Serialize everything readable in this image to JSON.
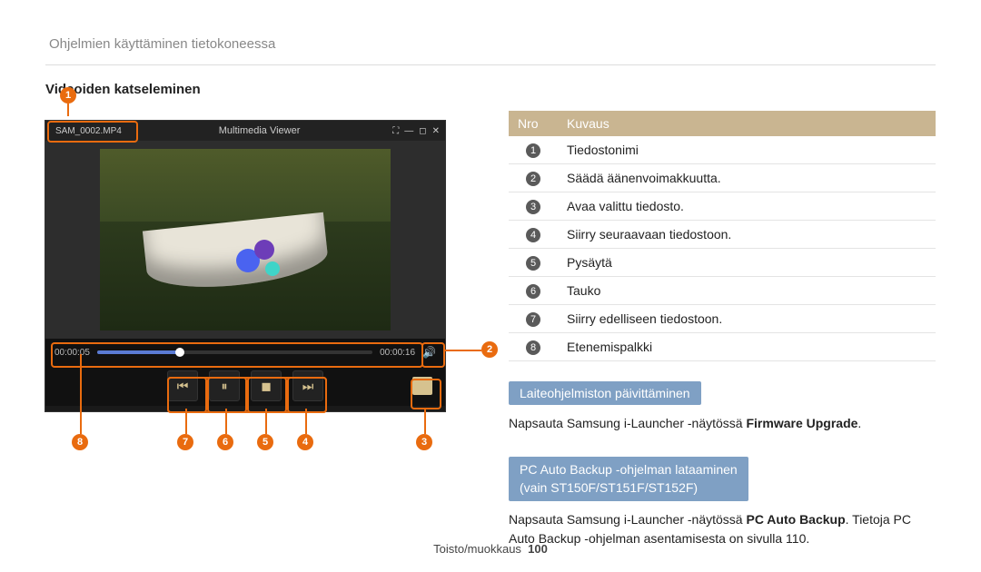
{
  "breadcrumb": "Ohjelmien käyttäminen tietokoneessa",
  "left": {
    "heading": "Videoiden katseleminen",
    "viewer_title": "Multimedia Viewer",
    "filename": "SAM_0002.MP4",
    "time_elapsed": "00:00:05",
    "time_total": "00:00:16"
  },
  "callouts": {
    "c1": "1",
    "c2": "2",
    "c3": "3",
    "c4": "4",
    "c5": "5",
    "c6": "6",
    "c7": "7",
    "c8": "8"
  },
  "table": {
    "header_num": "Nro",
    "header_desc": "Kuvaus",
    "rows": [
      {
        "n": "1",
        "desc": "Tiedostonimi"
      },
      {
        "n": "2",
        "desc": "Säädä äänenvoimakkuutta."
      },
      {
        "n": "3",
        "desc": "Avaa valittu tiedosto."
      },
      {
        "n": "4",
        "desc": "Siirry seuraavaan tiedostoon."
      },
      {
        "n": "5",
        "desc": "Pysäytä"
      },
      {
        "n": "6",
        "desc": "Tauko"
      },
      {
        "n": "7",
        "desc": "Siirry edelliseen tiedostoon."
      },
      {
        "n": "8",
        "desc": "Etenemispalkki"
      }
    ]
  },
  "block_firmware": {
    "title": "Laiteohjelmiston päivittäminen",
    "text_pre": "Napsauta Samsung i-Launcher -näytössä ",
    "text_bold": "Firmware Upgrade",
    "text_post": "."
  },
  "block_backup": {
    "title_line1": "PC Auto Backup -ohjelman lataaminen",
    "title_line2": "(vain ST150F/ST151F/ST152F)",
    "text_pre": "Napsauta Samsung i-Launcher -näytössä ",
    "text_bold": "PC Auto Backup",
    "text_post": ". Tietoja PC Auto Backup -ohjelman asentamisesta on sivulla 110."
  },
  "footer": {
    "section": "Toisto/muokkaus",
    "page": "100"
  }
}
